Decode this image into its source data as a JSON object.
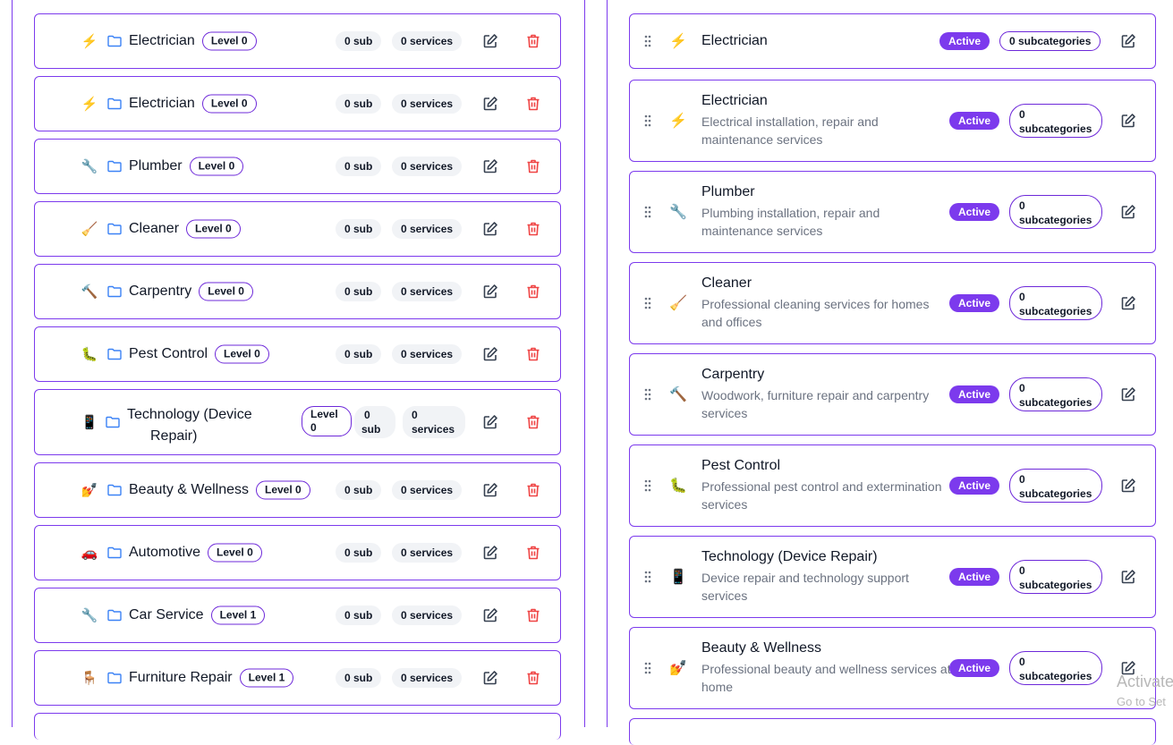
{
  "left_panel": {
    "categories": [
      {
        "icon": "lightning-icon",
        "emoji": "⚡",
        "name": "Electrician",
        "level": "Level 0",
        "sub": "0 sub",
        "services": "0 services"
      },
      {
        "icon": "lightning-icon",
        "emoji": "⚡",
        "name": "Electrician",
        "level": "Level 0",
        "sub": "0 sub",
        "services": "0 services"
      },
      {
        "icon": "wrench-icon",
        "emoji": "🔧",
        "name": "Plumber",
        "level": "Level 0",
        "sub": "0 sub",
        "services": "0 services"
      },
      {
        "icon": "broom-icon",
        "emoji": "🧹",
        "name": "Cleaner",
        "level": "Level 0",
        "sub": "0 sub",
        "services": "0 services"
      },
      {
        "icon": "hammer-icon",
        "emoji": "🔨",
        "name": "Carpentry",
        "level": "Level 0",
        "sub": "0 sub",
        "services": "0 services"
      },
      {
        "icon": "bug-icon",
        "emoji": "🐛",
        "name": "Pest Control",
        "level": "Level 0",
        "sub": "0 sub",
        "services": "0 services"
      },
      {
        "icon": "phone-icon",
        "emoji": "📱",
        "name": "Technology (Device Repair)",
        "name_line1": "Technology (Device",
        "name_line2": "Repair)",
        "level_line1": "Level",
        "level_line2": "0",
        "sub_line1": "0",
        "sub_line2": "sub",
        "services_line1": "0",
        "services_line2": "services"
      },
      {
        "icon": "nail-polish-icon",
        "emoji": "💅",
        "name": "Beauty & Wellness",
        "level": "Level 0",
        "sub": "0 sub",
        "services": "0 services"
      },
      {
        "icon": "car-icon",
        "emoji": "🚗",
        "name": "Automotive",
        "level": "Level 0",
        "sub": "0 sub",
        "services": "0 services"
      },
      {
        "icon": "wrench-icon",
        "emoji": "🔧",
        "name": "Car Service",
        "level": "Level 1",
        "sub": "0 sub",
        "services": "0 services"
      },
      {
        "icon": "chair-icon",
        "emoji": "🪑",
        "name": "Furniture Repair",
        "level": "Level 1",
        "sub": "0 sub",
        "services": "0 services"
      }
    ]
  },
  "right_panel": {
    "categories": [
      {
        "icon": "lightning-icon",
        "emoji": "⚡",
        "title": "Electrician",
        "description": "",
        "status": "Active",
        "subcategories": "0 subcategories"
      },
      {
        "icon": "lightning-icon",
        "emoji": "⚡",
        "title": "Electrician",
        "description": "Electrical installation, repair and maintenance services",
        "status": "Active",
        "subcat_line1": "0",
        "subcat_line2": "subcategories"
      },
      {
        "icon": "wrench-icon",
        "emoji": "🔧",
        "title": "Plumber",
        "description": "Plumbing installation, repair and maintenance services",
        "status": "Active",
        "subcat_line1": "0",
        "subcat_line2": "subcategories"
      },
      {
        "icon": "broom-icon",
        "emoji": "🧹",
        "title": "Cleaner",
        "description": "Professional cleaning services for homes and offices",
        "status": "Active",
        "subcat_line1": "0",
        "subcat_line2": "subcategories"
      },
      {
        "icon": "hammer-icon",
        "emoji": "🔨",
        "title": "Carpentry",
        "description": "Woodwork, furniture repair and carpentry services",
        "status": "Active",
        "subcat_line1": "0",
        "subcat_line2": "subcategories"
      },
      {
        "icon": "bug-icon",
        "emoji": "🐛",
        "title": "Pest Control",
        "description": "Professional pest control and extermination services",
        "status": "Active",
        "subcat_line1": "0",
        "subcat_line2": "subcategories"
      },
      {
        "icon": "phone-icon",
        "emoji": "📱",
        "title": "Technology (Device Repair)",
        "description": "Device repair and technology support services",
        "status": "Active",
        "subcat_line1": "0",
        "subcat_line2": "subcategories"
      },
      {
        "icon": "nail-polish-icon",
        "emoji": "💅",
        "title": "Beauty & Wellness",
        "description": "Professional beauty and wellness services at home",
        "status": "Active",
        "subcat_line1": "0",
        "subcat_line2": "subcategories"
      }
    ]
  },
  "watermark": {
    "line1": "Activate",
    "line2": "Go to Set"
  },
  "colors": {
    "accent": "#7c3aed",
    "delete": "#ef4444",
    "pill_bg": "#f1f3f6",
    "folder": "#3b82f6"
  }
}
